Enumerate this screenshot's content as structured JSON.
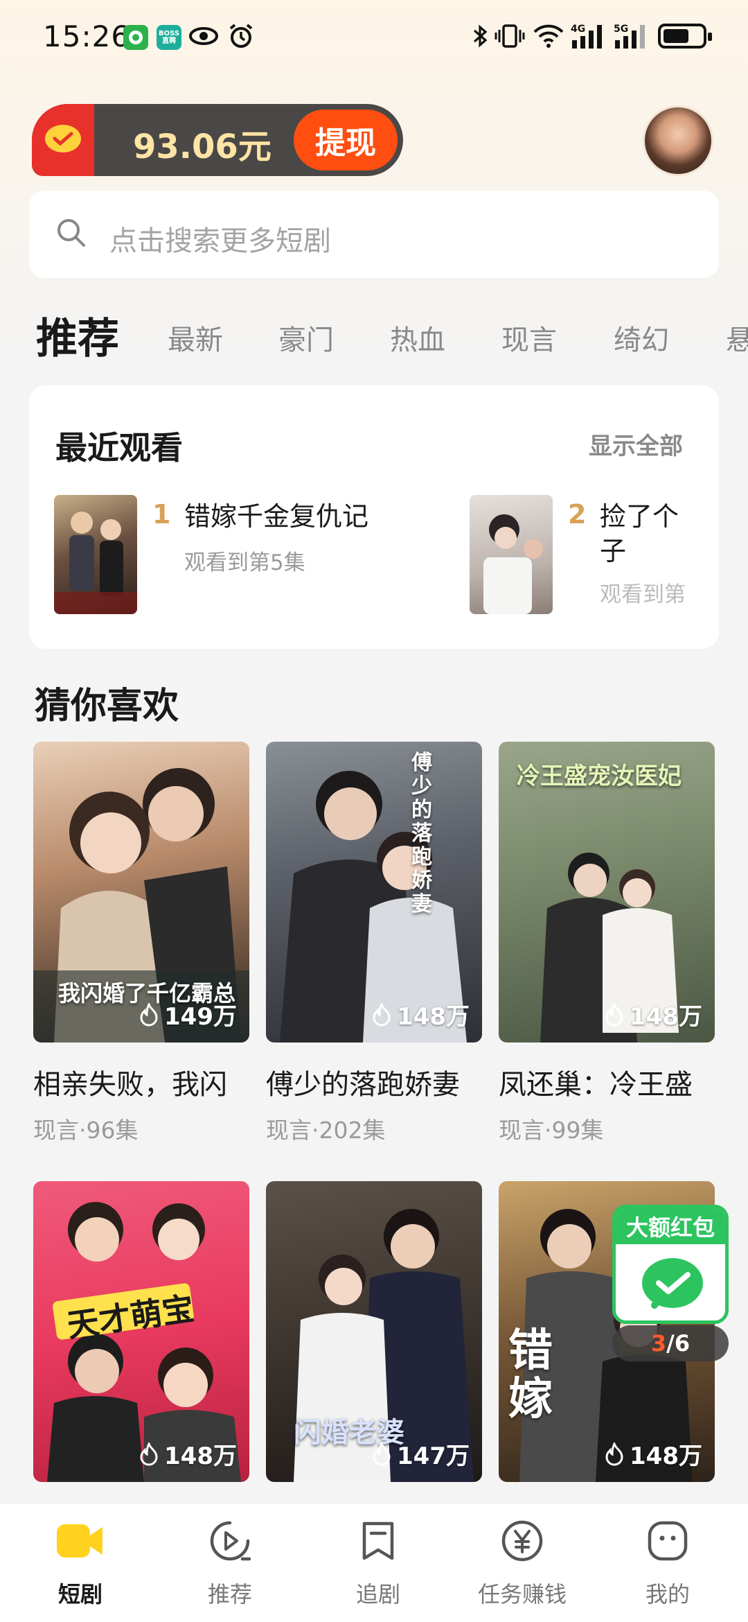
{
  "status_bar": {
    "time": "15:26",
    "app_icons": [
      "green-app-icon",
      "boss-app-icon",
      "eye-icon",
      "alarm-icon"
    ],
    "boss_label": "BOSS\n直聘",
    "system_icons": [
      "bluetooth-icon",
      "vibrate-icon",
      "wifi-icon",
      "signal-4g-icon",
      "signal-5g-icon",
      "battery-icon"
    ],
    "net1": "4G",
    "net2": "5G"
  },
  "wallet": {
    "amount": "93.06元",
    "withdraw_label": "提现",
    "colors": {
      "bar": "#4a4846",
      "amount": "#ffe4a6",
      "withdraw": "#ff4e10",
      "icon_bg": "#e8312b"
    }
  },
  "search": {
    "placeholder": "点击搜索更多短剧"
  },
  "tabs": [
    {
      "label": "推荐",
      "active": true
    },
    {
      "label": "最新"
    },
    {
      "label": "豪门"
    },
    {
      "label": "热血"
    },
    {
      "label": "现言"
    },
    {
      "label": "绮幻"
    },
    {
      "label": "悬"
    }
  ],
  "recent": {
    "title": "最近观看",
    "show_all": "显示全部",
    "items": [
      {
        "rank": "1",
        "title": "错嫁千金复仇记",
        "progress": "观看到第5集"
      },
      {
        "rank": "2",
        "title": "捡了个",
        "title2": "子",
        "progress": "观看到第"
      }
    ]
  },
  "guess": {
    "title": "猜你喜欢",
    "cards": [
      {
        "title": "相亲失败，我闪",
        "meta": "现言·96集",
        "views": "149万",
        "poster_text": "我闪婚了千亿霸总"
      },
      {
        "title": "傅少的落跑娇妻",
        "meta": "现言·202集",
        "views": "148万",
        "poster_text": "傅少的落跑娇妻"
      },
      {
        "title": "凤还巢：冷王盛",
        "meta": "现言·99集",
        "views": "148万",
        "poster_text": "冷王盛宠汝医妃"
      },
      {
        "title": "",
        "meta": "",
        "views": "148万",
        "poster_text": "天才萌宝"
      },
      {
        "title": "",
        "meta": "",
        "views": "147万",
        "poster_text": "闪婚老婆"
      },
      {
        "title": "",
        "meta": "",
        "views": "148万",
        "poster_text": "错嫁"
      }
    ]
  },
  "red_packet": {
    "label": "大额红包",
    "current": "3",
    "total": "/6",
    "color": "#2dc460"
  },
  "bottom_nav": [
    {
      "label": "短剧",
      "icon": "short-drama-camera-icon",
      "active": true
    },
    {
      "label": "推荐",
      "icon": "play-circle-icon"
    },
    {
      "label": "追剧",
      "icon": "bookmark-icon"
    },
    {
      "label": "任务赚钱",
      "icon": "yuan-coin-icon"
    },
    {
      "label": "我的",
      "icon": "profile-face-icon"
    }
  ]
}
